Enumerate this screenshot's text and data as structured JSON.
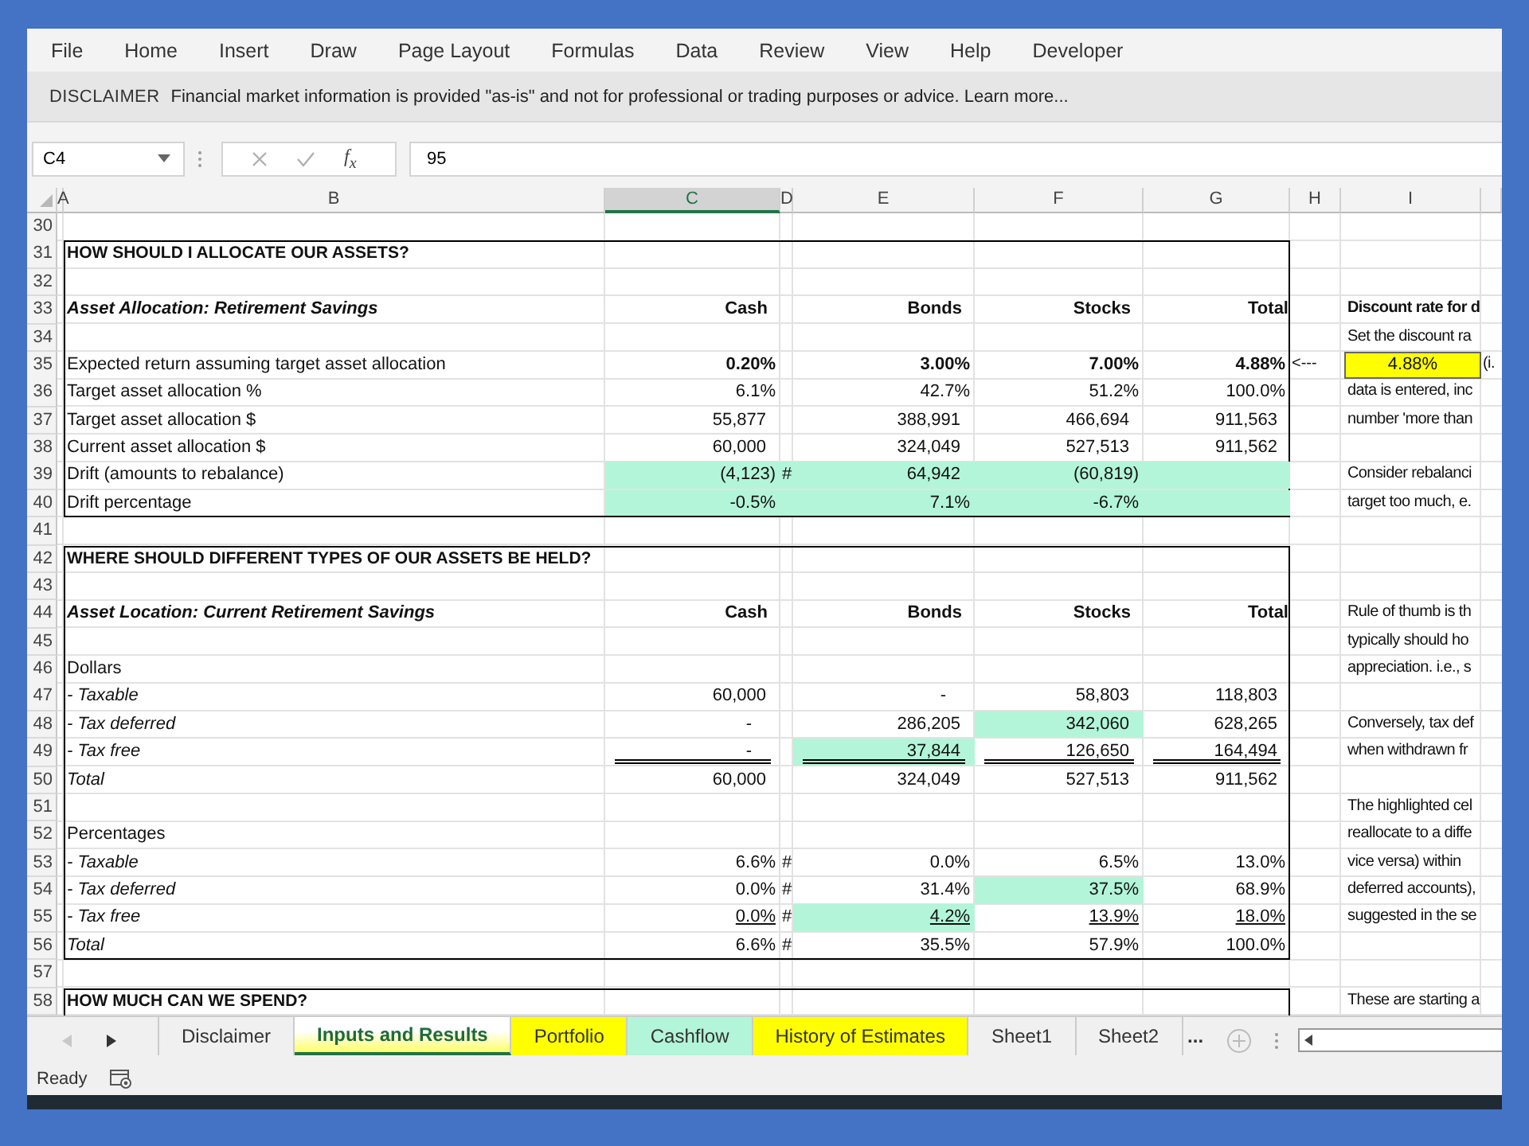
{
  "menu": [
    "File",
    "Home",
    "Insert",
    "Draw",
    "Page Layout",
    "Formulas",
    "Data",
    "Review",
    "View",
    "Help",
    "Developer"
  ],
  "message_bar": {
    "title": "DISCLAIMER",
    "text": "Financial market information is provided \"as-is\" and not for professional or trading purposes or advice. Learn more..."
  },
  "formula_bar": {
    "name_box": "C4",
    "function_label": "f$_{x}$",
    "value": "95"
  },
  "column_headers": [
    {
      "label": "A",
      "selected": false
    },
    {
      "label": "B",
      "selected": false
    },
    {
      "label": "C",
      "selected": true
    },
    {
      "label": "D",
      "selected": false
    },
    {
      "label": "E",
      "selected": false
    },
    {
      "label": "F",
      "selected": false
    },
    {
      "label": "G",
      "selected": false
    },
    {
      "label": "H",
      "selected": false
    },
    {
      "label": "I",
      "selected": false
    }
  ],
  "blocks": [
    {
      "rows": [
        {
          "num": "30",
          "cells": {}
        }
      ]
    },
    {
      "boxed": true,
      "rows": [
        {
          "num": "31",
          "cells": {
            "B": {
              "kind": "heading",
              "text": "HOW SHOULD I ALLOCATE OUR ASSETS?"
            }
          }
        },
        {
          "num": "32",
          "cells": {}
        },
        {
          "num": "33",
          "cells": {
            "B": {
              "kind": "subheading",
              "text": "Asset Allocation: Retirement Savings"
            },
            "C": {
              "kind": "header",
              "text": "Cash"
            },
            "E": {
              "kind": "header",
              "text": "Bonds"
            },
            "F": {
              "kind": "header",
              "text": "Stocks"
            },
            "G": {
              "kind": "header",
              "text": "Total"
            },
            "I": {
              "kind": "note-heading",
              "text": "Discount rate for d"
            }
          }
        },
        {
          "num": "34",
          "cells": {
            "I": {
              "kind": "note",
              "text": "Set the discount ra"
            }
          }
        },
        {
          "num": "35",
          "cells": {
            "B": {
              "kind": "label",
              "text": "Expected return assuming target asset allocation"
            },
            "C": {
              "kind": "strong",
              "text": "0.20%"
            },
            "E": {
              "kind": "strong",
              "text": "3.00%"
            },
            "F": {
              "kind": "strong",
              "text": "7.00%"
            },
            "G": {
              "kind": "strong",
              "text": "4.88%"
            },
            "H": {
              "kind": "arrow",
              "text": "<---"
            },
            "I": {
              "kind": "input",
              "text": "4.88%"
            },
            "J": {
              "kind": "note",
              "text": "(i."
            }
          }
        },
        {
          "num": "36",
          "cells": {
            "B": {
              "kind": "label",
              "text": "Target asset allocation %"
            },
            "C": {
              "kind": "number",
              "text": "6.1%"
            },
            "E": {
              "kind": "number",
              "text": "42.7%"
            },
            "F": {
              "kind": "number",
              "text": "51.2%"
            },
            "G": {
              "kind": "number",
              "text": "100.0%"
            },
            "I": {
              "kind": "note",
              "text": "data is entered, inc"
            }
          }
        },
        {
          "num": "37",
          "cells": {
            "B": {
              "kind": "label",
              "text": "Target asset allocation $"
            },
            "C": {
              "kind": "amount",
              "text": "55,877"
            },
            "E": {
              "kind": "amount",
              "text": "388,991"
            },
            "F": {
              "kind": "amount",
              "text": "466,694"
            },
            "G": {
              "kind": "amount",
              "text": "911,563"
            },
            "I": {
              "kind": "note",
              "text": "number 'more than"
            }
          }
        },
        {
          "num": "38",
          "cells": {
            "B": {
              "kind": "label",
              "text": "Current asset allocation $"
            },
            "C": {
              "kind": "amount",
              "text": "60,000"
            },
            "E": {
              "kind": "amount",
              "text": "324,049"
            },
            "F": {
              "kind": "amount",
              "text": "527,513"
            },
            "G": {
              "kind": "amount",
              "text": "911,562"
            }
          }
        },
        {
          "num": "39",
          "cells": {
            "B": {
              "kind": "label",
              "text": "Drift (amounts to rebalance)"
            },
            "C": {
              "kind": "number",
              "text": "(4,123)",
              "highlighted": true
            },
            "D": {
              "kind": "marker",
              "text": "#",
              "highlighted": true
            },
            "E": {
              "kind": "amount",
              "text": "64,942",
              "highlighted": true
            },
            "F": {
              "kind": "number",
              "text": "(60,819)",
              "highlighted": true
            },
            "G": {
              "highlighted": true
            },
            "I": {
              "kind": "note",
              "text": "Consider rebalanci"
            }
          }
        },
        {
          "num": "40",
          "cells": {
            "B": {
              "kind": "label",
              "text": "Drift percentage"
            },
            "C": {
              "kind": "number",
              "text": "-0.5%",
              "highlighted": true
            },
            "D": {
              "highlighted": true
            },
            "E": {
              "kind": "number",
              "text": "7.1%",
              "highlighted": true
            },
            "F": {
              "kind": "number",
              "text": "-6.7%",
              "highlighted": true
            },
            "G": {
              "highlighted": true
            },
            "I": {
              "kind": "note",
              "text": "target too much, e."
            }
          }
        }
      ]
    },
    {
      "rows": [
        {
          "num": "41",
          "cells": {}
        }
      ]
    },
    {
      "boxed": true,
      "rows": [
        {
          "num": "42",
          "cells": {
            "B": {
              "kind": "heading",
              "text": "WHERE SHOULD DIFFERENT TYPES OF OUR ASSETS BE HELD?"
            }
          }
        },
        {
          "num": "43",
          "cells": {}
        },
        {
          "num": "44",
          "cells": {
            "B": {
              "kind": "subheading",
              "text": "Asset Location: Current Retirement Savings"
            },
            "C": {
              "kind": "header",
              "text": "Cash"
            },
            "E": {
              "kind": "header",
              "text": "Bonds"
            },
            "F": {
              "kind": "header",
              "text": "Stocks"
            },
            "G": {
              "kind": "header",
              "text": "Total"
            },
            "I": {
              "kind": "note",
              "text": "Rule of thumb is th"
            }
          }
        },
        {
          "num": "45",
          "cells": {
            "I": {
              "kind": "note",
              "text": "typically should ho"
            }
          }
        },
        {
          "num": "46",
          "cells": {
            "B": {
              "kind": "label",
              "text": "Dollars"
            },
            "I": {
              "kind": "note",
              "text": "appreciation. i.e., s"
            }
          }
        },
        {
          "num": "47",
          "cells": {
            "B": {
              "kind": "sublabel",
              "text": "- Taxable"
            },
            "C": {
              "kind": "amount",
              "text": "60,000"
            },
            "E": {
              "kind": "dash",
              "text": "-"
            },
            "F": {
              "kind": "amount",
              "text": "58,803"
            },
            "G": {
              "kind": "amount",
              "text": "118,803"
            }
          }
        },
        {
          "num": "48",
          "cells": {
            "B": {
              "kind": "sublabel",
              "text": "- Tax deferred"
            },
            "C": {
              "kind": "dash",
              "text": "-"
            },
            "E": {
              "kind": "amount",
              "text": "286,205"
            },
            "F": {
              "kind": "amount",
              "text": "342,060",
              "highlighted": true
            },
            "G": {
              "kind": "amount",
              "text": "628,265"
            },
            "I": {
              "kind": "note",
              "text": "Conversely, tax def"
            }
          }
        },
        {
          "num": "49",
          "cells": {
            "B": {
              "kind": "sublabel",
              "text": "- Tax free"
            },
            "C": {
              "kind": "dash",
              "text": "-",
              "rule_below": true
            },
            "E": {
              "kind": "amount",
              "text": "37,844",
              "highlighted": true,
              "rule_below": true
            },
            "F": {
              "kind": "amount",
              "text": "126,650",
              "rule_below": true
            },
            "G": {
              "kind": "amount",
              "text": "164,494",
              "rule_below": true
            },
            "I": {
              "kind": "note",
              "text": "when withdrawn fr"
            }
          }
        },
        {
          "num": "50",
          "cells": {
            "B": {
              "kind": "sublabel",
              "text": "Total"
            },
            "C": {
              "kind": "amount",
              "text": "60,000"
            },
            "E": {
              "kind": "amount",
              "text": "324,049"
            },
            "F": {
              "kind": "amount",
              "text": "527,513"
            },
            "G": {
              "kind": "amount",
              "text": "911,562"
            }
          }
        },
        {
          "num": "51",
          "cells": {
            "I": {
              "kind": "note",
              "text": "The highlighted cel"
            }
          }
        },
        {
          "num": "52",
          "cells": {
            "B": {
              "kind": "label",
              "text": "Percentages"
            },
            "I": {
              "kind": "note",
              "text": "reallocate to a diffe"
            }
          }
        },
        {
          "num": "53",
          "cells": {
            "B": {
              "kind": "sublabel",
              "text": "- Taxable"
            },
            "C": {
              "kind": "number",
              "text": "6.6%"
            },
            "D": {
              "kind": "marker",
              "text": "#"
            },
            "E": {
              "kind": "number",
              "text": "0.0%"
            },
            "F": {
              "kind": "number",
              "text": "6.5%"
            },
            "G": {
              "kind": "number",
              "text": "13.0%"
            },
            "I": {
              "kind": "note",
              "text": "vice versa) within"
            }
          }
        },
        {
          "num": "54",
          "cells": {
            "B": {
              "kind": "sublabel",
              "text": "- Tax deferred"
            },
            "C": {
              "kind": "number",
              "text": "0.0%"
            },
            "D": {
              "kind": "marker",
              "text": "#"
            },
            "E": {
              "kind": "number",
              "text": "31.4%"
            },
            "F": {
              "kind": "number",
              "text": "37.5%",
              "highlighted": true
            },
            "G": {
              "kind": "number",
              "text": "68.9%"
            },
            "I": {
              "kind": "note",
              "text": "deferred accounts),"
            }
          }
        },
        {
          "num": "55",
          "cells": {
            "B": {
              "kind": "sublabel",
              "text": "- Tax free"
            },
            "C": {
              "kind": "number",
              "text": "0.0%",
              "underlined": true
            },
            "D": {
              "kind": "marker",
              "text": "#"
            },
            "E": {
              "kind": "number",
              "text": "4.2%",
              "highlighted": true,
              "underlined": true
            },
            "F": {
              "kind": "number",
              "text": "13.9%",
              "underlined": true
            },
            "G": {
              "kind": "number",
              "text": "18.0%",
              "underlined": true
            },
            "I": {
              "kind": "note",
              "text": "suggested in the se"
            }
          }
        },
        {
          "num": "56",
          "cells": {
            "B": {
              "kind": "sublabel",
              "text": "Total"
            },
            "C": {
              "kind": "number",
              "text": "6.6%"
            },
            "D": {
              "kind": "marker",
              "text": "#"
            },
            "E": {
              "kind": "number",
              "text": "35.5%"
            },
            "F": {
              "kind": "number",
              "text": "57.9%"
            },
            "G": {
              "kind": "number",
              "text": "100.0%"
            }
          }
        }
      ]
    },
    {
      "rows": [
        {
          "num": "57",
          "cells": {}
        }
      ]
    },
    {
      "boxed": true,
      "continues": true,
      "rows": [
        {
          "num": "58",
          "cells": {
            "B": {
              "kind": "heading",
              "text": "HOW MUCH CAN WE SPEND?"
            },
            "I": {
              "kind": "note",
              "text": "These are starting a"
            }
          }
        }
      ]
    }
  ],
  "sheet_tabs": [
    {
      "label": "Disclaimer",
      "selected": false
    },
    {
      "label": "Inputs and Results",
      "selected": true,
      "color": "#ffff66"
    },
    {
      "label": "Portfolio",
      "selected": false,
      "color": "#ffff00"
    },
    {
      "label": "Cashflow",
      "selected": false,
      "color": "#b3f5d8"
    },
    {
      "label": "History of Estimates",
      "selected": false,
      "color": "#ffff00"
    },
    {
      "label": "Sheet1",
      "selected": false
    },
    {
      "label": "Sheet2",
      "selected": false
    }
  ],
  "more_tabs": "...",
  "status": "Ready"
}
